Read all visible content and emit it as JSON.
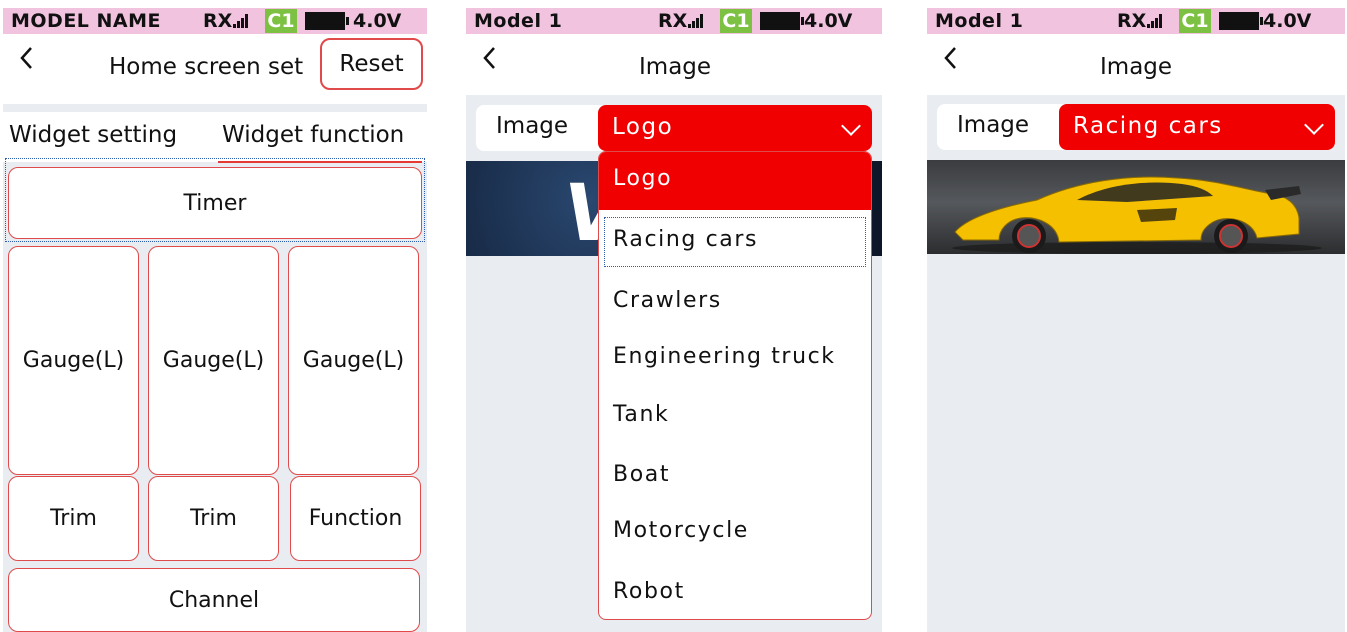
{
  "screens": [
    {
      "status": {
        "model": "MODEL NAME",
        "rx": "RX",
        "c1": "C1",
        "voltage": "4.0V"
      },
      "nav": {
        "title": "Home screen set",
        "reset_label": "Reset"
      },
      "tabs": [
        {
          "label": "Widget setting",
          "active": false
        },
        {
          "label": "Widget function",
          "active": true
        }
      ],
      "widgets": {
        "timer": "Timer",
        "gauges": [
          "Gauge(L)",
          "Gauge(L)",
          "Gauge(L)"
        ],
        "trims": [
          "Trim",
          "Trim"
        ],
        "function": "Function",
        "channel": "Channel"
      }
    },
    {
      "status": {
        "model": "Model 1",
        "rx": "RX",
        "c1": "C1",
        "voltage": "4.0V"
      },
      "nav": {
        "title": "Image"
      },
      "field": {
        "label": "Image",
        "value": "Logo"
      },
      "dropdown": {
        "options": [
          "Logo",
          "Racing cars",
          "Crawlers",
          "Engineering truck",
          "Tank",
          "Boat",
          "Motorcycle",
          "Robot"
        ],
        "selected": "Logo",
        "focused": "Racing cars"
      },
      "banner_letter": "V"
    },
    {
      "status": {
        "model": "Model 1",
        "rx": "RX",
        "c1": "C1",
        "voltage": "4.0V"
      },
      "nav": {
        "title": "Image"
      },
      "field": {
        "label": "Image",
        "value": "Racing cars"
      }
    }
  ],
  "colors": {
    "accent_red": "#f00000",
    "status_bg": "#f1c3df",
    "c1_green": "#7dc142",
    "border_red": "#e04a4a",
    "focus_blue": "#2a5db0"
  },
  "icons": {
    "back": "chevron-left-icon",
    "signal": "signal-bars-icon",
    "battery": "battery-icon",
    "dropdown": "chevron-down-icon"
  }
}
